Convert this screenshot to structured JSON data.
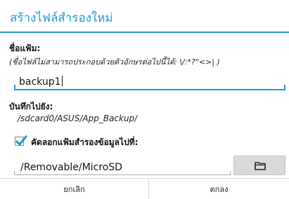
{
  "dialog": {
    "title": "สร้างไฟล์สำรองใหม่",
    "accent_color": "#1e9ad6"
  },
  "name_section": {
    "label": "ชื่อแฟ้ม:",
    "hint": "(ชื่อไฟล์ไม่สามารถประกอบด้วยตัวอักษรต่อไปนี้ได้: \\/:*?\"<>| )",
    "input_value": "backup1"
  },
  "save_section": {
    "label": "บันทึกไปยัง:",
    "path": "/sdcard0/ASUS/App_Backup/"
  },
  "copy_option": {
    "label": "คัดลอกแฟ้มสำรองข้อมูลไปที่:",
    "checked": true,
    "destination": "/Removable/MicroSD",
    "browse_icon": "folder-icon"
  },
  "buttons": {
    "cancel": "ยกเลิก",
    "ok": "ตกลง"
  }
}
